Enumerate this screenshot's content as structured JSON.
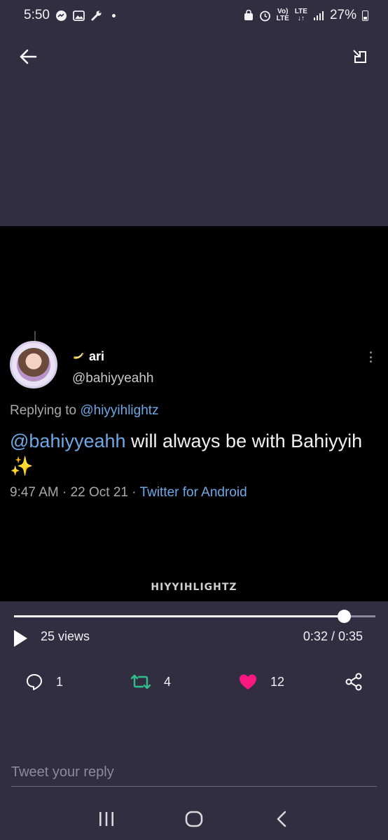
{
  "status_bar": {
    "time": "5:50",
    "lte_top": "Vo)",
    "lte_bottom": "LTE",
    "lte2_top": "LTE",
    "lte2_bottom": "↓↑",
    "battery": "27%"
  },
  "tweet": {
    "display_name": "ari",
    "handle": "@bahiyyeahh",
    "replying_prefix": "Replying to",
    "replying_to": "@hiyyihlightz",
    "mention": "@bahiyyeahh",
    "text_part1": " will always be with Bahiyyih",
    "sparkle": "✨",
    "time": "9:47 AM",
    "separator": "·",
    "date": "22 Oct 21",
    "source": "Twitter for Android",
    "watermark": "HIYYIHLIGHTZ"
  },
  "player": {
    "views": "25 views",
    "time": "0:32 / 0:35",
    "progress": 0.914
  },
  "actions": {
    "reply_count": "1",
    "retweet_count": "4",
    "like_count": "12"
  },
  "reply_box": {
    "placeholder": "Tweet your reply"
  },
  "colors": {
    "background": "#312e42",
    "link": "#6fa8e6",
    "retweet": "#2fbf8a",
    "like": "#f91880"
  }
}
